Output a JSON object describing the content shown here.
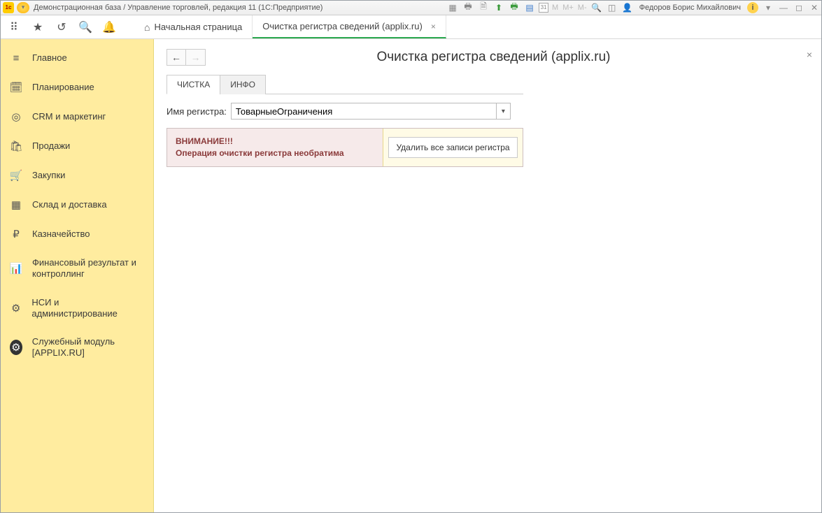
{
  "titlebar": {
    "logo_text": "1c",
    "title": "Демонстрационная база / Управление торговлей, редакция 11  (1С:Предприятие)",
    "m_labels": [
      "M",
      "M+",
      "M-"
    ],
    "user_name": "Федоров Борис Михайлович",
    "cal_text": "31"
  },
  "tabs": {
    "home": "Начальная страница",
    "active": "Очистка регистра сведений (applix.ru)"
  },
  "sidebar": {
    "items": [
      {
        "icon": "≡",
        "label": "Главное"
      },
      {
        "icon": "🗓",
        "label": "Планирование"
      },
      {
        "icon": "◎",
        "label": "CRM и маркетинг"
      },
      {
        "icon": "🛍",
        "label": "Продажи"
      },
      {
        "icon": "🛒",
        "label": "Закупки"
      },
      {
        "icon": "▦",
        "label": "Склад и доставка"
      },
      {
        "icon": "₽",
        "label": "Казначейство"
      },
      {
        "icon": "📊",
        "label": "Финансовый результат и контроллинг"
      },
      {
        "icon": "⚙",
        "label": "НСИ и администрирование"
      },
      {
        "icon": "⚙",
        "label": "Служебный модуль [APPLIX.RU]"
      }
    ]
  },
  "content": {
    "page_title": "Очистка регистра сведений (applix.ru)",
    "tab_clean": "ЧИСТКА",
    "tab_info": "ИНФО",
    "field_label": "Имя регистра:",
    "field_value": "ТоварныеОграничения",
    "warn_line1": "ВНИМАНИЕ!!!",
    "warn_line2": "Операция очистки регистра необратима",
    "delete_button": "Удалить все записи регистра"
  }
}
